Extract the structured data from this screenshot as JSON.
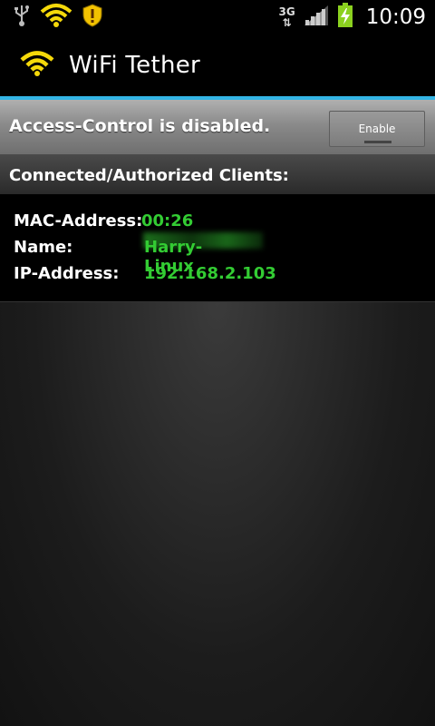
{
  "status_bar": {
    "time": "10:09",
    "network_type": "3G",
    "icons": [
      "usb-icon",
      "wifi-hotspot-icon",
      "security-shield-icon",
      "signal-icon",
      "battery-charging-icon"
    ]
  },
  "app": {
    "title": "WiFi Tether"
  },
  "access_control": {
    "status_text": "Access-Control is disabled.",
    "enable_label": "Enable"
  },
  "clients_header": "Connected/Authorized Clients:",
  "client": {
    "mac_label": "MAC-Address:",
    "mac_value": "00:26",
    "name_label": "Name:",
    "name_value": "Harry-Linux",
    "ip_label": "IP-Address:",
    "ip_value": "192.168.2.103"
  },
  "colors": {
    "accent": "#33b5e5",
    "value_green": "#33cc33",
    "wifi_yellow": "#f5d90a",
    "battery_green": "#8bd11f"
  }
}
